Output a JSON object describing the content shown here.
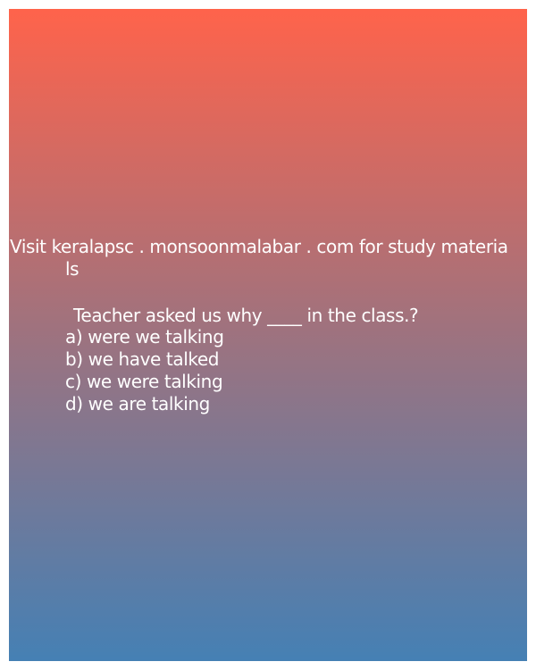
{
  "visit_line1": "Visit keralapsc . monsoonmalabar . com for study materia",
  "visit_line2": "ls",
  "question": "Teacher asked us why ____ in the class.?",
  "options": [
    "a) were we talking",
    "b) we have talked",
    "c) we were talking",
    "d) we are talking"
  ],
  "colors": {
    "gradient_top": "#ff634b",
    "gradient_bottom": "#4580b4",
    "text": "#ffffff"
  }
}
